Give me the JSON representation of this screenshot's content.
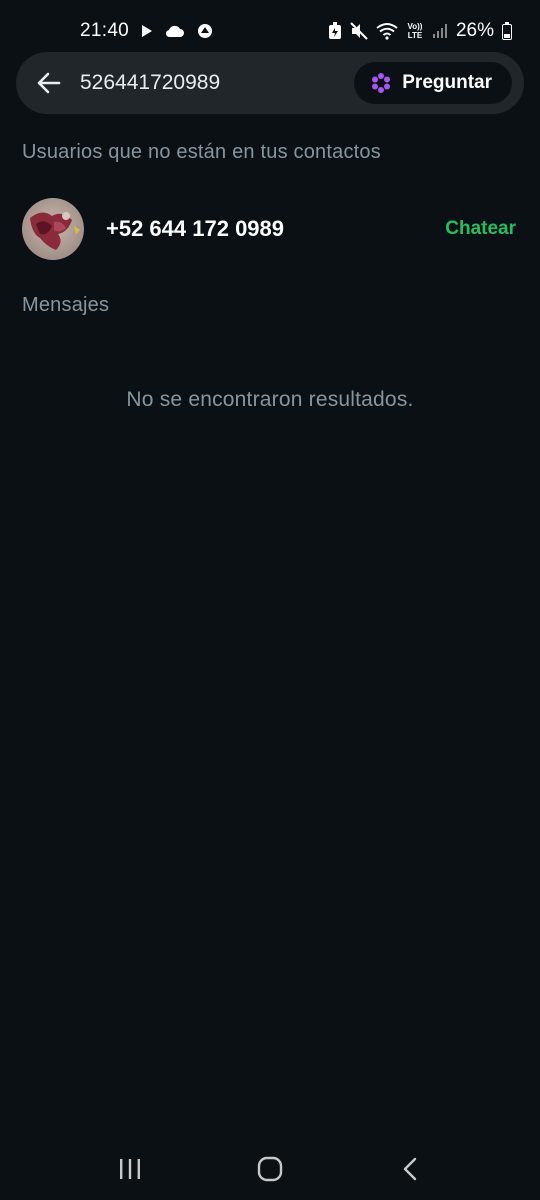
{
  "status_bar": {
    "time": "21:40",
    "battery": "26%",
    "icons": [
      "play-icon",
      "cloud-icon",
      "sync-icon",
      "battery-saver-icon",
      "mute-icon",
      "wifi-icon",
      "volte-icon",
      "signal-icon",
      "battery-icon"
    ],
    "volte_text": "Vo)) LTE"
  },
  "search": {
    "query": "526441720989",
    "ask_button_label": "Preguntar",
    "ask_icon": "meta-ai-icon",
    "ask_icon_color": "#a855f7"
  },
  "contacts_section": {
    "title": "Usuarios que no están en tus contactos",
    "results": [
      {
        "phone": "+52 644 172 0989",
        "action_label": "Chatear"
      }
    ]
  },
  "messages_section": {
    "title": "Mensajes",
    "empty_text": "No se encontraron resultados."
  },
  "nav_bar": {
    "buttons": [
      "recent-apps-icon",
      "home-icon",
      "back-icon"
    ]
  },
  "colors": {
    "background": "#0b1014",
    "search_background": "#20262a",
    "accent_green": "#21c063",
    "muted_text": "#8696a0"
  }
}
